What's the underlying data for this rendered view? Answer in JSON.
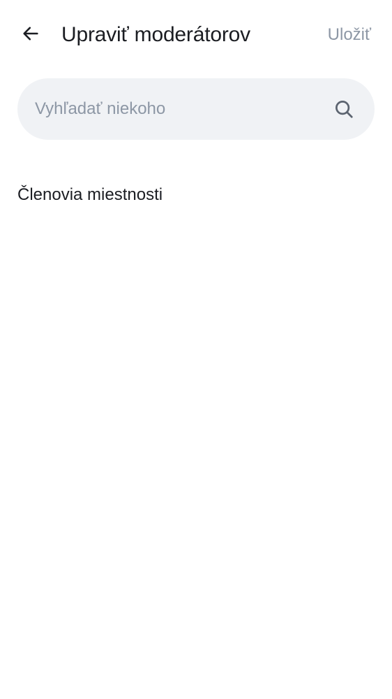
{
  "header": {
    "back_icon": "arrow-left-icon",
    "title": "Upraviť moderátorov",
    "save_label": "Uložiť",
    "save_color": "#8d97a5"
  },
  "search": {
    "placeholder": "Vyhľadať niekoho",
    "value": "",
    "icon": "search-icon",
    "background": "#f0f2f5"
  },
  "members": {
    "heading": "Členovia miestnosti",
    "items": []
  }
}
